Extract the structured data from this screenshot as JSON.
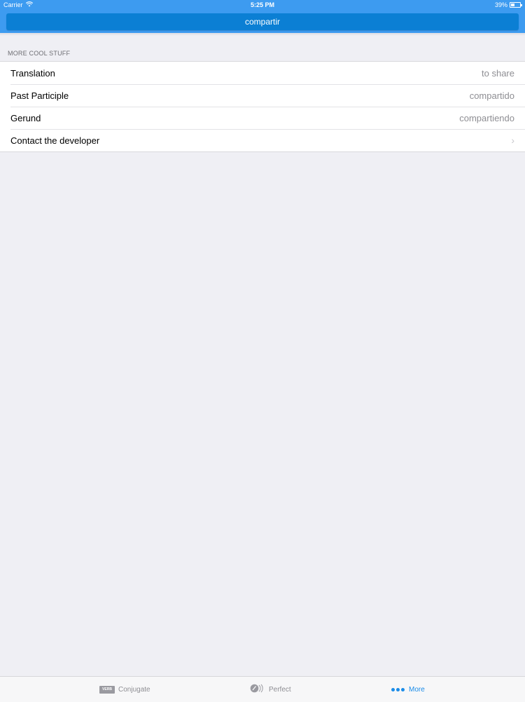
{
  "status_bar": {
    "carrier": "Carrier",
    "time": "5:25 PM",
    "battery": "39%",
    "battery_level": 0.39
  },
  "nav": {
    "title": "compartir"
  },
  "section": {
    "header": "MORE COOL STUFF",
    "rows": [
      {
        "label": "Translation",
        "value": "to share"
      },
      {
        "label": "Past Participle",
        "value": "compartido"
      },
      {
        "label": "Gerund",
        "value": "compartiendo"
      },
      {
        "label": "Contact the developer",
        "value": ""
      }
    ]
  },
  "tab_bar": {
    "tabs": [
      {
        "label": "Conjugate",
        "icon": "verb-icon",
        "icon_text": "VERB"
      },
      {
        "label": "Perfect",
        "icon": "perfect-icon"
      },
      {
        "label": "More",
        "icon": "more-icon"
      }
    ],
    "active_tab": "More",
    "active_color": "#1a8ce8"
  },
  "colors": {
    "accent": "#3d9bf0",
    "title_button": "#0b7fd4",
    "background": "#efeff4"
  }
}
